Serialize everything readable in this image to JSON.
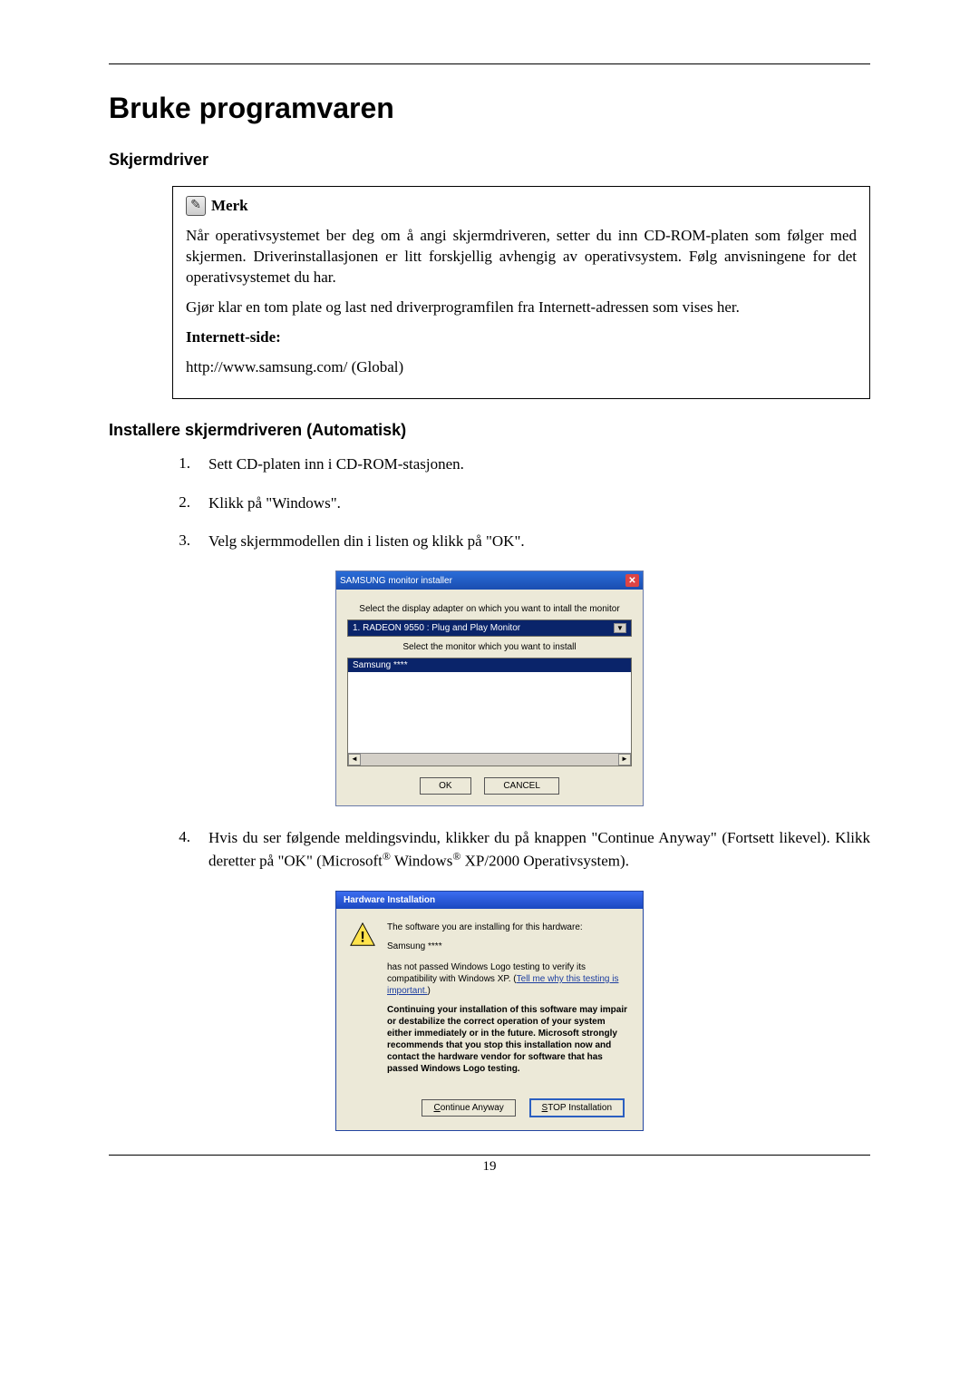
{
  "page": {
    "title": "Bruke programvaren",
    "section1": "Skjermdriver",
    "note_label": "Merk",
    "note_p1": "Når operativsystemet ber deg om å angi skjermdriveren, setter du inn CD-ROM-platen som følger med skjermen. Driverinstallasjonen er litt forskjellig avhengig av operativsystem. Følg anvisningene for det operativsystemet du har.",
    "note_p2": "Gjør klar en tom plate og last ned driverprogramfilen fra Internett-adressen som vises her.",
    "internet_label": "Internett-side:",
    "url": "http://www.samsung.com/ (Global)",
    "section2": "Installere skjermdriveren (Automatisk)",
    "steps": {
      "s1": "Sett CD-platen inn i CD-ROM-stasjonen.",
      "s2": "Klikk på \"Windows\".",
      "s3": "Velg skjermmodellen din i listen og klikk på \"OK\".",
      "s4_a": "Hvis du ser følgende meldingsvindu, klikker du på knappen \"Continue Anyway\" (Fortsett likevel). Klikk deretter på \"OK\" (Microsoft",
      "s4_b": " Windows",
      "s4_c": " XP/2000 Operativsystem)."
    },
    "number": "19"
  },
  "installer": {
    "title": "SAMSUNG monitor installer",
    "line1": "Select the display adapter on which you want to intall the monitor",
    "dropdown": "1. RADEON 9550 : Plug and Play Monitor",
    "line2": "Select the monitor which you want to install",
    "selected": "Samsung ****",
    "ok": "OK",
    "cancel": "CANCEL"
  },
  "hw": {
    "title": "Hardware Installation",
    "p1": "The software you are installing for this hardware:",
    "device": "Samsung ****",
    "p2a": "has not passed Windows Logo testing to verify its compatibility with Windows XP. (",
    "link": "Tell me why this testing is important.",
    "p2b": ")",
    "p3": "Continuing your installation of this software may impair or destabilize the correct operation of your system either immediately or in the future. Microsoft strongly recommends that you stop this installation now and contact the hardware vendor for software that has passed Windows Logo testing.",
    "continue": "Continue Anyway",
    "stop": "STOP Installation"
  }
}
